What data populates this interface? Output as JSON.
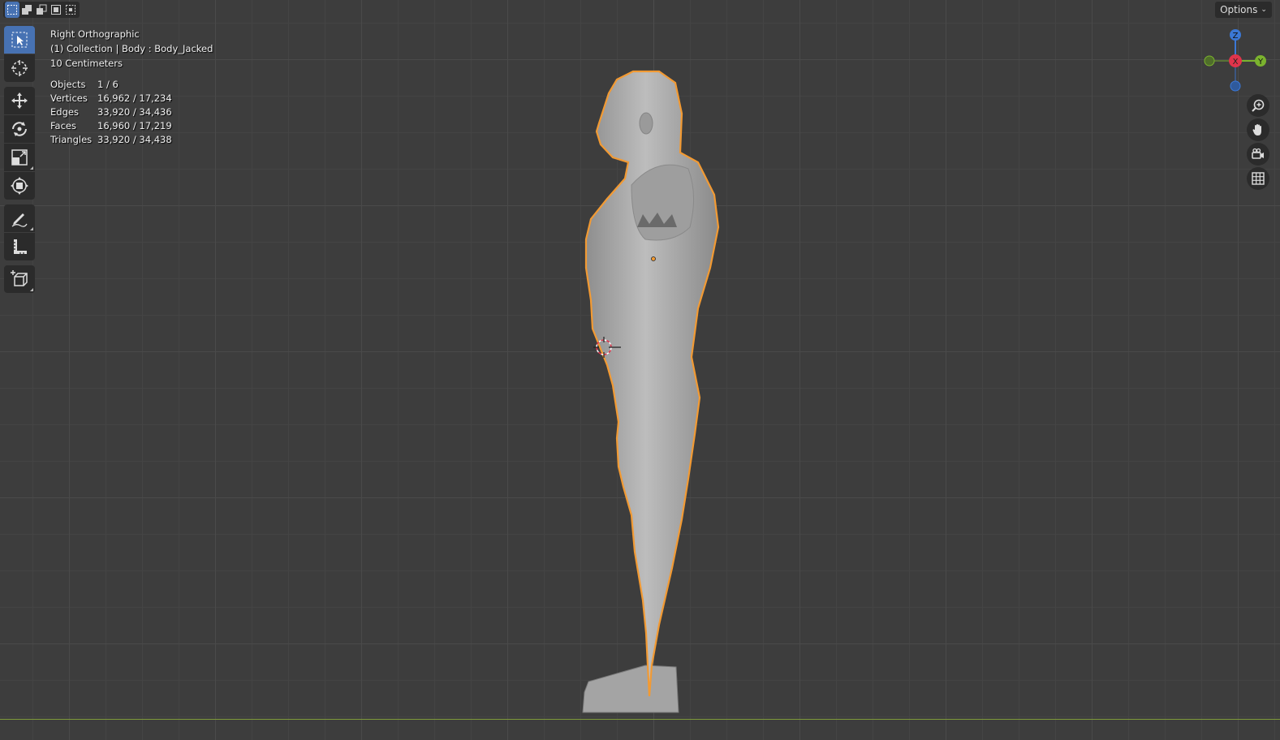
{
  "viewport": {
    "view_name": "Right Orthographic",
    "collection_line": "(1) Collection | Body : Body_Jacked",
    "scale_label": "10 Centimeters"
  },
  "stats": [
    {
      "label": "Objects",
      "value": "1 / 6"
    },
    {
      "label": "Vertices",
      "value": "16,962 / 17,234"
    },
    {
      "label": "Edges",
      "value": "33,920 / 34,436"
    },
    {
      "label": "Faces",
      "value": "16,960 / 17,219"
    },
    {
      "label": "Triangles",
      "value": "33,920 / 34,438"
    }
  ],
  "header": {
    "options_label": "Options",
    "selection_modes": [
      "select-box-icon",
      "extend-icon",
      "subtract-icon",
      "invert-icon",
      "intersect-icon"
    ]
  },
  "toolbar": {
    "tools": [
      "select-box-icon",
      "cursor-icon",
      "move-icon",
      "rotate-icon",
      "scale-icon",
      "transform-icon",
      "annotate-icon",
      "measure-icon",
      "add-cube-icon"
    ]
  },
  "gizmo": {
    "z_label": "Z",
    "x_label": "X",
    "y_label": "Y",
    "colors": {
      "x": "#e0344b",
      "y": "#7bb32e",
      "z": "#3b78d6"
    }
  },
  "colors": {
    "accent": "#4772b3",
    "selection_outline": "#f29a33",
    "grid_bg": "#3d3d3d",
    "ground_line": "#7f9a3a"
  }
}
